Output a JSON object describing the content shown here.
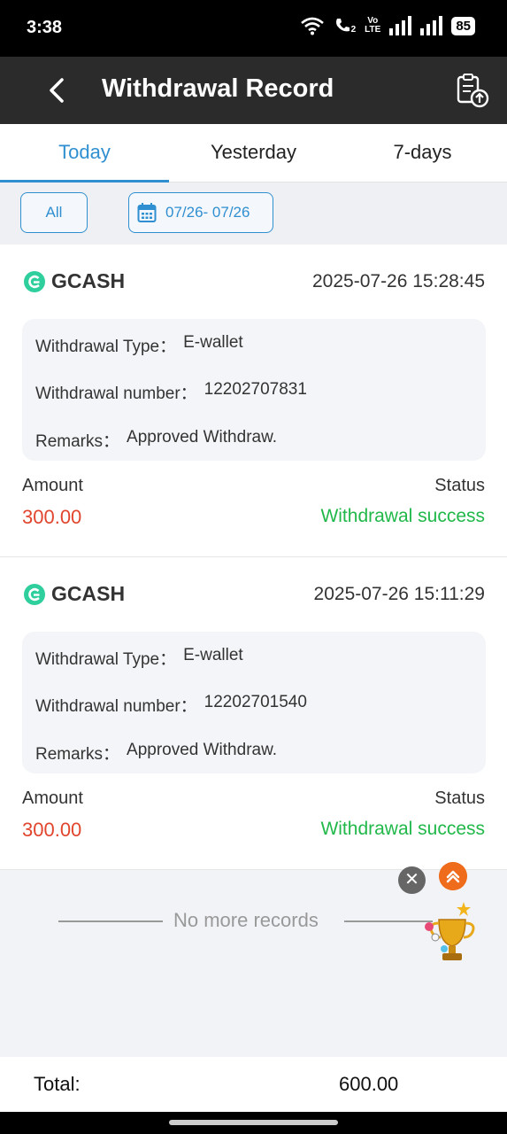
{
  "status_bar": {
    "time": "3:38",
    "battery": "85",
    "volte_top": "Vo",
    "volte_bottom": "LTE",
    "sim_index": "2"
  },
  "header": {
    "title": "Withdrawal Record"
  },
  "tabs": [
    {
      "label": "Today",
      "active": true
    },
    {
      "label": "Yesterday",
      "active": false
    },
    {
      "label": "7-days",
      "active": false
    }
  ],
  "filter": {
    "all_label": "All",
    "date_range": "07/26- 07/26"
  },
  "records": [
    {
      "method": "GCASH",
      "datetime": "2025-07-26 15:28:45",
      "type_label": "Withdrawal Type：",
      "type_value": "E-wallet",
      "number_label": "Withdrawal number：",
      "number_value": "12202707831",
      "remarks_label": "Remarks：",
      "remarks_value": "Approved Withdraw.",
      "amount_label": "Amount",
      "amount_value": "300.00",
      "status_label": "Status",
      "status_value": "Withdrawal success"
    },
    {
      "method": "GCASH",
      "datetime": "2025-07-26 15:11:29",
      "type_label": "Withdrawal Type：",
      "type_value": "E-wallet",
      "number_label": "Withdrawal number：",
      "number_value": "12202701540",
      "remarks_label": "Remarks：",
      "remarks_value": "Approved Withdraw.",
      "amount_label": "Amount",
      "amount_value": "300.00",
      "status_label": "Status",
      "status_value": "Withdrawal success"
    }
  ],
  "no_more_text": "No more records",
  "total": {
    "label": "Total:",
    "value": "600.00"
  },
  "colors": {
    "accent": "#2f8fd0",
    "amount": "#e1452e",
    "success": "#21b84a",
    "header_bg": "#2b2b2b",
    "gcash": "#2ecf9c"
  },
  "icons": [
    "back-arrow-icon",
    "upload-record-icon",
    "calendar-icon",
    "gcash-logo-icon",
    "close-icon",
    "scroll-top-icon",
    "trophy-icon"
  ]
}
